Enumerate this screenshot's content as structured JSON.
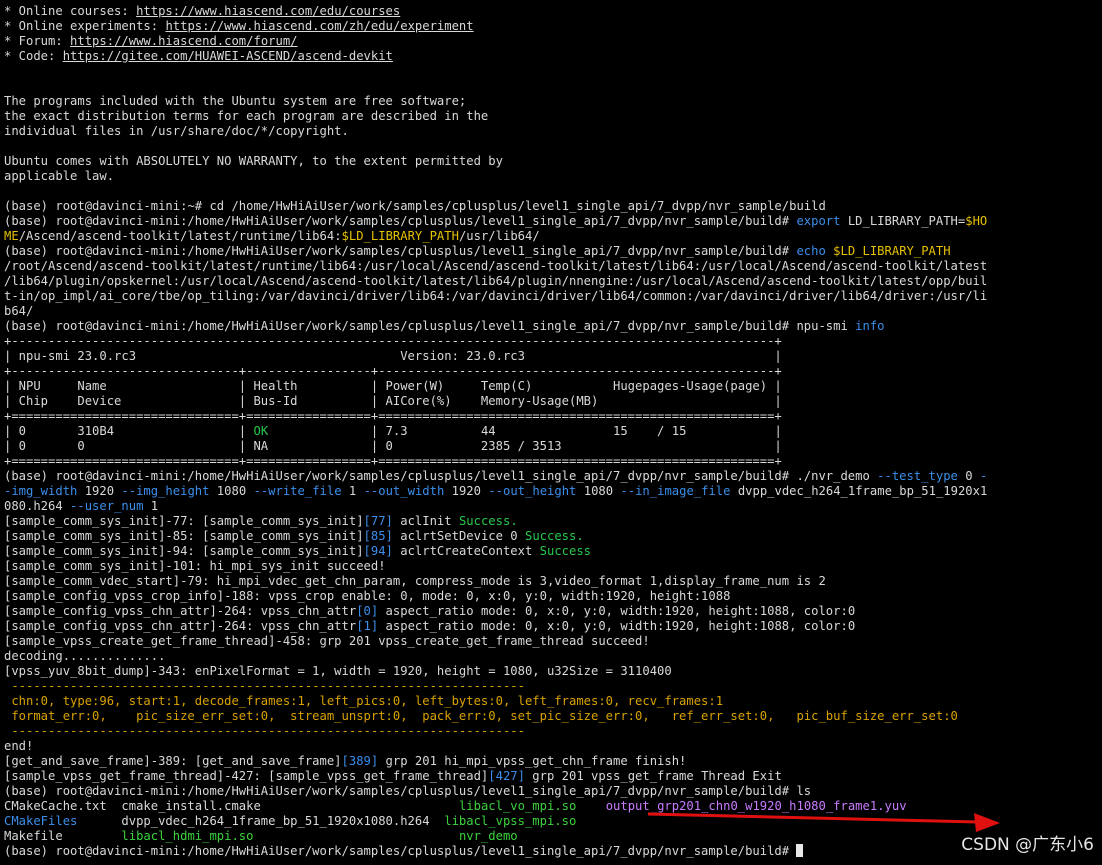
{
  "lines": [
    [
      {
        "t": "* Online courses: "
      },
      {
        "t": "https://www.hiascend.com/edu/courses",
        "c": "u"
      }
    ],
    [
      {
        "t": "* Online experiments: "
      },
      {
        "t": "https://www.hiascend.com/zh/edu/experiment",
        "c": "u"
      }
    ],
    [
      {
        "t": "* Forum: "
      },
      {
        "t": "https://www.hiascend.com/forum/",
        "c": "u"
      }
    ],
    [
      {
        "t": "* Code: "
      },
      {
        "t": "https://gitee.com/HUAWEI-ASCEND/ascend-devkit",
        "c": "u"
      }
    ],
    [
      {
        "t": ""
      }
    ],
    [
      {
        "t": ""
      }
    ],
    [
      {
        "t": "The programs included with the Ubuntu system are free software;"
      }
    ],
    [
      {
        "t": "the exact distribution terms for each program are described in the"
      }
    ],
    [
      {
        "t": "individual files in /usr/share/doc/*/copyright."
      }
    ],
    [
      {
        "t": ""
      }
    ],
    [
      {
        "t": "Ubuntu comes with ABSOLUTELY NO WARRANTY, to the extent permitted by"
      }
    ],
    [
      {
        "t": "applicable law."
      }
    ],
    [
      {
        "t": ""
      }
    ],
    [
      {
        "t": "(base) root@davinci-mini:~# cd /home/HwHiAiUser/work/samples/cplusplus/level1_single_api/7_dvpp/nvr_sample/build"
      }
    ],
    [
      {
        "t": "(base) root@davinci-mini:/home/HwHiAiUser/work/samples/cplusplus/level1_single_api/7_dvpp/nvr_sample/build# "
      },
      {
        "t": "export",
        "c": "b"
      },
      {
        "t": " LD_LIBRARY_PATH="
      },
      {
        "t": "$HO",
        "c": "y"
      }
    ],
    [
      {
        "t": "ME",
        "c": "y"
      },
      {
        "t": "/Ascend/ascend-toolkit/latest/runtime/lib64:"
      },
      {
        "t": "$LD_LIBRARY_PATH",
        "c": "y"
      },
      {
        "t": "/usr/lib64/"
      }
    ],
    [
      {
        "t": "(base) root@davinci-mini:/home/HwHiAiUser/work/samples/cplusplus/level1_single_api/7_dvpp/nvr_sample/build# "
      },
      {
        "t": "echo",
        "c": "b"
      },
      {
        "t": " "
      },
      {
        "t": "$LD_LIBRARY_PATH",
        "c": "y"
      }
    ],
    [
      {
        "t": "/root/Ascend/ascend-toolkit/latest/runtime/lib64:/usr/local/Ascend/ascend-toolkit/latest/lib64:/usr/local/Ascend/ascend-toolkit/latest"
      }
    ],
    [
      {
        "t": "/lib64/plugin/opskernel:/usr/local/Ascend/ascend-toolkit/latest/lib64/plugin/nnengine:/usr/local/Ascend/ascend-toolkit/latest/opp/buil"
      }
    ],
    [
      {
        "t": "t-in/op_impl/ai_core/tbe/op_tiling:/var/davinci/driver/lib64:/var/davinci/driver/lib64/common:/var/davinci/driver/lib64/driver:/usr/li"
      }
    ],
    [
      {
        "t": "b64/"
      }
    ],
    [
      {
        "t": "(base) root@davinci-mini:/home/HwHiAiUser/work/samples/cplusplus/level1_single_api/7_dvpp/nvr_sample/build# npu-smi "
      },
      {
        "t": "info",
        "c": "b"
      }
    ],
    [
      {
        "t": "+--------------------------------------------------------------------------------------------------------+"
      }
    ],
    [
      {
        "t": "| npu-smi 23.0.rc3                                    Version: 23.0.rc3                                  |"
      }
    ],
    [
      {
        "t": "+-------------------------------+-----------------+------------------------------------------------------+"
      }
    ],
    [
      {
        "t": "| NPU     Name                  | Health          | Power(W)     Temp(C)           Hugepages-Usage(page) |"
      }
    ],
    [
      {
        "t": "| Chip    Device                | Bus-Id          | AICore(%)    Memory-Usage(MB)                        |"
      }
    ],
    [
      {
        "t": "+===============================+=================+======================================================+"
      }
    ],
    [
      {
        "t": "| 0       310B4                 | "
      },
      {
        "t": "OK",
        "c": "g"
      },
      {
        "t": "              | 7.3          44                15    / 15            |"
      }
    ],
    [
      {
        "t": "| 0       0                     | NA              | 0            2385 / 3513                             |"
      }
    ],
    [
      {
        "t": "+===============================+=================+======================================================+"
      }
    ],
    [
      {
        "t": "(base) root@davinci-mini:/home/HwHiAiUser/work/samples/cplusplus/level1_single_api/7_dvpp/nvr_sample/build# ./nvr_demo "
      },
      {
        "t": "--test_type",
        "c": "b"
      },
      {
        "t": " 0 "
      },
      {
        "t": "-",
        "c": "b"
      }
    ],
    [
      {
        "t": "-img_width",
        "c": "b"
      },
      {
        "t": " 1920 "
      },
      {
        "t": "--img_height",
        "c": "b"
      },
      {
        "t": " 1080 "
      },
      {
        "t": "--write_file",
        "c": "b"
      },
      {
        "t": " 1 "
      },
      {
        "t": "--out_width",
        "c": "b"
      },
      {
        "t": " 1920 "
      },
      {
        "t": "--out_height",
        "c": "b"
      },
      {
        "t": " 1080 "
      },
      {
        "t": "--in_image_file",
        "c": "b"
      },
      {
        "t": " dvpp_vdec_h264_1frame_bp_51_1920x1"
      }
    ],
    [
      {
        "t": "080.h264 "
      },
      {
        "t": "--user_num",
        "c": "b"
      },
      {
        "t": " 1"
      }
    ],
    [
      {
        "t": "[sample_comm_sys_init]-77: [sample_comm_sys_init]"
      },
      {
        "t": "[77]",
        "c": "b"
      },
      {
        "t": " aclInit "
      },
      {
        "t": "Success.",
        "c": "g"
      }
    ],
    [
      {
        "t": "[sample_comm_sys_init]-85: [sample_comm_sys_init]"
      },
      {
        "t": "[85]",
        "c": "b"
      },
      {
        "t": " aclrtSetDevice 0 "
      },
      {
        "t": "Success.",
        "c": "g"
      }
    ],
    [
      {
        "t": "[sample_comm_sys_init]-94: [sample_comm_sys_init]"
      },
      {
        "t": "[94]",
        "c": "b"
      },
      {
        "t": " aclrtCreateContext "
      },
      {
        "t": "Success",
        "c": "g"
      }
    ],
    [
      {
        "t": "[sample_comm_sys_init]-101: hi_mpi_sys_init succeed!"
      }
    ],
    [
      {
        "t": "[sample_comm_vdec_start]-79: hi_mpi_vdec_get_chn_param, compress_mode is 3,video_format 1,display_frame_num is 2"
      }
    ],
    [
      {
        "t": "[sample_config_vpss_crop_info]-188: vpss_crop enable: 0, mode: 0, x:0, y:0, width:1920, height:1088"
      }
    ],
    [
      {
        "t": "[sample_config_vpss_chn_attr]-264: vpss_chn_attr"
      },
      {
        "t": "[0]",
        "c": "b"
      },
      {
        "t": " aspect_ratio mode: 0, x:0, y:0, width:1920, height:1088, color:0"
      }
    ],
    [
      {
        "t": "[sample_config_vpss_chn_attr]-264: vpss_chn_attr"
      },
      {
        "t": "[1]",
        "c": "b"
      },
      {
        "t": " aspect_ratio mode: 0, x:0, y:0, width:1920, height:1088, color:0"
      }
    ],
    [
      {
        "t": "[sample_vpss_create_get_frame_thread]-458: grp 201 vpss_create_get_frame_thread succeed!"
      }
    ],
    [
      {
        "t": "decoding.............."
      }
    ],
    [
      {
        "t": "[vpss_yuv_8bit_dump]-343: enPixelFormat = 1, width = 1920, height = 1080, u32Size = 3110400"
      }
    ],
    [
      {
        "t": " ----------------------------------------------------------------------",
        "c": "y2"
      }
    ],
    [
      {
        "t": " chn:0, type:96, start:1, decode_frames:1, left_pics:0, left_bytes:0, left_frames:0, recv_frames:1",
        "c": "y2"
      }
    ],
    [
      {
        "t": " format_err:0,    pic_size_err_set:0,  stream_unsprt:0,  pack_err:0, set_pic_size_err:0,   ref_err_set:0,   pic_buf_size_err_set:0",
        "c": "y2"
      }
    ],
    [
      {
        "t": " ----------------------------------------------------------------------",
        "c": "y2"
      }
    ],
    [
      {
        "t": "end!"
      }
    ],
    [
      {
        "t": "[get_and_save_frame]-389: [get_and_save_frame]"
      },
      {
        "t": "[389]",
        "c": "b"
      },
      {
        "t": " grp 201 hi_mpi_vpss_get_chn_frame finish!"
      }
    ],
    [
      {
        "t": "[sample_vpss_get_frame_thread]-427: [sample_vpss_get_frame_thread]"
      },
      {
        "t": "[427]",
        "c": "b"
      },
      {
        "t": " grp 201 vpss_get_frame Thread Exit"
      }
    ],
    [
      {
        "t": "(base) root@davinci-mini:/home/HwHiAiUser/work/samples/cplusplus/level1_single_api/7_dvpp/nvr_sample/build# ls"
      }
    ],
    [
      {
        "t": "CMakeCache.txt  cmake_install.cmake                           "
      },
      {
        "t": "libacl_vo_mpi.so",
        "c": "grn"
      },
      {
        "t": "    "
      },
      {
        "t": "output_grp201_chn0_w1920_h1080_frame1.yuv",
        "c": "m"
      }
    ],
    [
      {
        "t": "CMakeFiles",
        "c": "b"
      },
      {
        "t": "      dvpp_vdec_h264_1frame_bp_51_1920x1080.h264  "
      },
      {
        "t": "libacl_vpss_mpi.so",
        "c": "grn"
      }
    ],
    [
      {
        "t": "Makefile        "
      },
      {
        "t": "libacl_hdmi_mpi.so",
        "c": "grn"
      },
      {
        "t": "                            "
      },
      {
        "t": "nvr_demo",
        "c": "grn"
      }
    ],
    [
      {
        "t": "(base) root@davinci-mini:/home/HwHiAiUser/work/samples/cplusplus/level1_single_api/7_dvpp/nvr_sample/build# "
      }
    ]
  ],
  "watermark": "CSDN @广东小6",
  "colors": {
    "background": "#000000",
    "text": "#d9d9d9",
    "success": "#27c94d",
    "option": "#3b8eea",
    "variable": "#e5c100",
    "stats": "#d8a200",
    "output_file": "#c97bff",
    "annotation_arrow": "#e01010"
  }
}
